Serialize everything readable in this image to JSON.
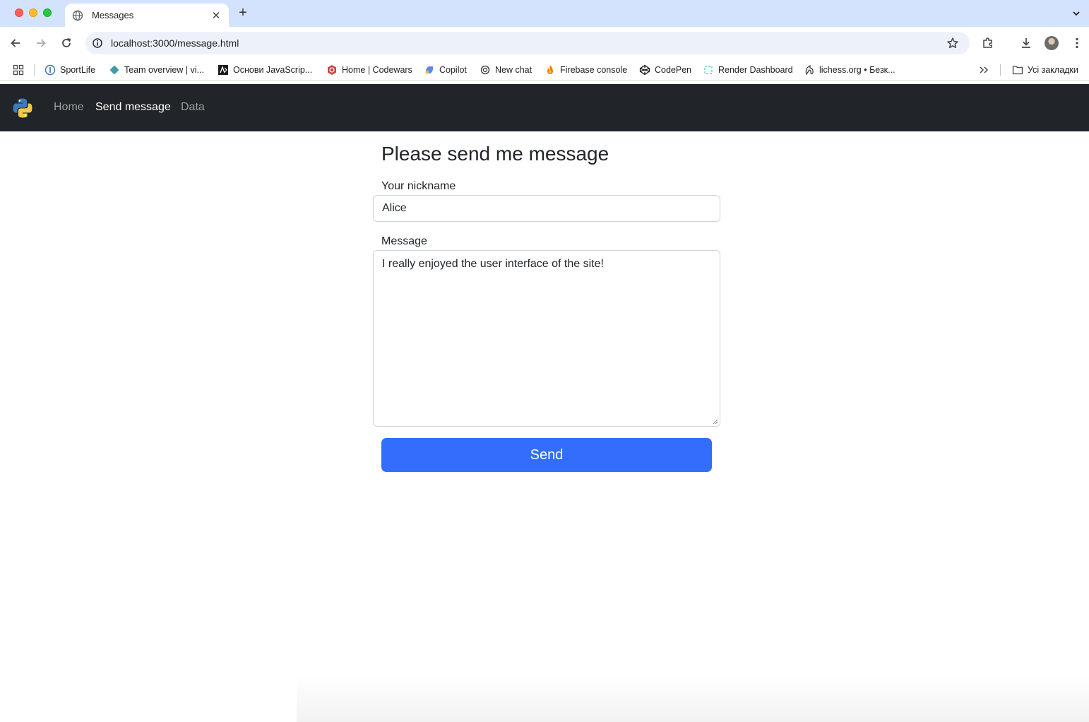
{
  "browser": {
    "tab_title": "Messages",
    "url": "localhost:3000/message.html",
    "bookmarks": [
      {
        "label": "SportLife",
        "icon": "sportlife-icon"
      },
      {
        "label": "Team overview | vi...",
        "icon": "team-overview-icon"
      },
      {
        "label": "Основи JavaScrip...",
        "icon": "javascript-course-icon"
      },
      {
        "label": "Home | Codewars",
        "icon": "codewars-icon"
      },
      {
        "label": "Copilot",
        "icon": "copilot-icon"
      },
      {
        "label": "New chat",
        "icon": "chatgpt-icon"
      },
      {
        "label": "Firebase console",
        "icon": "firebase-icon"
      },
      {
        "label": "CodePen",
        "icon": "codepen-icon"
      },
      {
        "label": "Render Dashboard",
        "icon": "render-icon"
      },
      {
        "label": "lichess.org • Безк...",
        "icon": "lichess-icon"
      }
    ],
    "all_bookmarks_label": "Усі закладки",
    "accent_color": "#d3e3fd",
    "annotation_color": "#e8412b"
  },
  "page": {
    "nav": {
      "links": [
        "Home",
        "Send message",
        "Data"
      ],
      "active": "Send message"
    },
    "title": "Please send me message",
    "form": {
      "nickname_label": "Your nickname",
      "nickname_value": "Alice",
      "message_label": "Message",
      "message_value": "I really enjoyed the user interface of the site!",
      "send_label": "Send"
    },
    "colors": {
      "navbar": "#212529",
      "primary_button": "#336dfb"
    }
  }
}
